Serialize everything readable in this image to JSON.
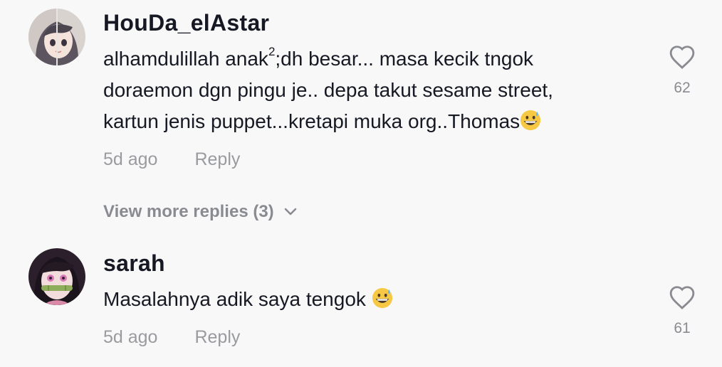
{
  "comments": [
    {
      "username": "HouDa_elAstar",
      "text_part1": "alhamdulillah anak",
      "text_sup": "2",
      "text_part2": ";dh besar... masa kecik tngok\ndoraemon dgn pingu je.. depa takut sesame street,\nkartun jenis puppet...kretapi muka org..Thomas",
      "emoji": "grinning-sweat-emoji",
      "time": "5d ago",
      "reply_label": "Reply",
      "likes": "62",
      "avatar_icon": "anime-girl-avatar"
    },
    {
      "username": "sarah",
      "text": "Masalahnya adik saya tengok ",
      "emoji": "grinning-sweat-emoji",
      "time": "5d ago",
      "reply_label": "Reply",
      "likes": "61",
      "avatar_icon": "anime-girl-bamboo-avatar"
    }
  ],
  "view_more_replies": "View more replies (3)",
  "colors": {
    "background": "#f8f8f8",
    "text_primary": "#161823",
    "text_secondary": "#9a9ba0",
    "heart_outline": "#8a8b91",
    "emoji_yellow": "#f7c843"
  }
}
